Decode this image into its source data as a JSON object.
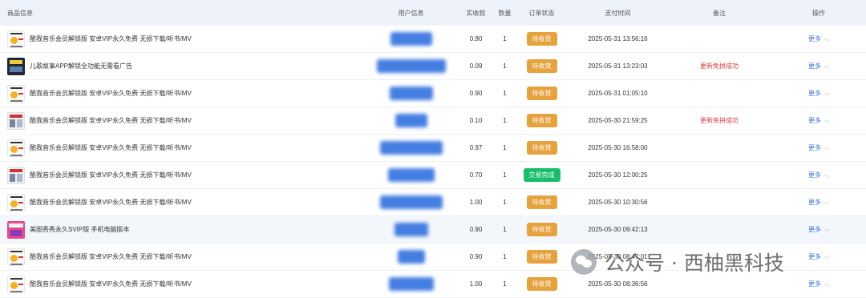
{
  "header": {
    "product": "商品信息",
    "user": "用户信息",
    "paid": "实收款",
    "qty": "数量",
    "status": "订单状态",
    "time": "支付时间",
    "note": "备注",
    "op": "操作"
  },
  "rows": [
    {
      "product": "酷我音乐会员解锁版 安卓VIP永久免费 无损下载/听书/MV",
      "paid": "0.90",
      "qty": "1",
      "status": "待收货",
      "time": "2025-05-31 13:56:16",
      "note": "",
      "op": "更多"
    },
    {
      "product": "儿歌故事APP解锁全功能无需看广告",
      "paid": "0.09",
      "qty": "1",
      "status": "待收货",
      "time": "2025-05-31 13:23:03",
      "note": "更新免拼成功",
      "op": "更多"
    },
    {
      "product": "酷我音乐会员解锁版 安卓VIP永久免费 无损下载/听书/MV",
      "paid": "0.90",
      "qty": "1",
      "status": "待收货",
      "time": "2025-05-31 01:05:10",
      "note": "",
      "op": "更多"
    },
    {
      "product": "酷我音乐会员解锁版 安卓VIP永久免费 无损下载/听书/MV",
      "paid": "0.10",
      "qty": "1",
      "status": "待收货",
      "time": "2025-05-30 21:59:25",
      "note": "更新免拼成功",
      "op": "更多"
    },
    {
      "product": "酷我音乐会员解锁版 安卓VIP永久免费 无损下载/听书/MV",
      "paid": "0.97",
      "qty": "1",
      "status": "待收货",
      "time": "2025-05-30 16:58:00",
      "note": "",
      "op": "更多"
    },
    {
      "product": "酷我音乐会员解锁版 安卓VIP永久免费 无损下载/听书/MV",
      "paid": "0.70",
      "qty": "1",
      "status": "交易完成",
      "time": "2025-05-30 12:00:25",
      "note": "",
      "op": "更多"
    },
    {
      "product": "酷我音乐会员解锁版 安卓VIP永久免费 无损下载/听书/MV",
      "paid": "1.00",
      "qty": "1",
      "status": "待收货",
      "time": "2025-05-30 10:30:56",
      "note": "",
      "op": "更多"
    },
    {
      "product": "美图秀秀永久SVIP版 手机电脑版本",
      "paid": "0.90",
      "qty": "1",
      "status": "待收货",
      "time": "2025-05-30 09:42:13",
      "note": "",
      "op": "更多"
    },
    {
      "product": "酷我音乐会员解锁版 安卓VIP永久免费 无损下载/听书/MV",
      "paid": "0.90",
      "qty": "1",
      "status": "待收货",
      "time": "2025-05-30 08:47:01",
      "note": "",
      "op": "更多"
    },
    {
      "product": "酷我音乐会员解锁版 安卓VIP永久免费 无损下载/听书/MV",
      "paid": "1.00",
      "qty": "1",
      "status": "待收货",
      "time": "2025-05-30 08:36:56",
      "note": "",
      "op": "更多"
    }
  ],
  "colors": {
    "pending": "#e6a23c",
    "done": "#19be6b",
    "link": "#3a72e0",
    "note": "#e03a3a",
    "header_bg": "#eef2fb"
  },
  "watermark": {
    "text": "公众号 · 西柚黑科技",
    "icon": "wechat-icon"
  }
}
